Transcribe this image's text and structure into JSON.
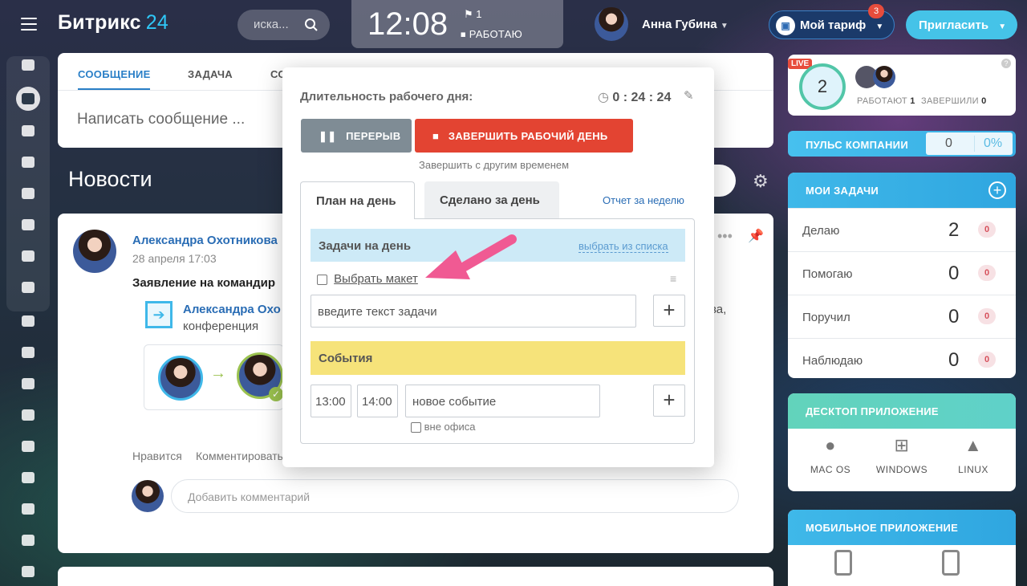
{
  "header": {
    "logo_main": "Битрикс",
    "logo_num": "24",
    "search_placeholder": "иска...",
    "clock_time": "12:08",
    "flag_count": "1",
    "work_status": "РАБОТАЮ",
    "user_name": "Анна Губина",
    "tariff_label": "Мой тариф",
    "tariff_badge": "3",
    "invite_label": "Пригласить"
  },
  "composer": {
    "tabs": [
      "СООБЩЕНИЕ",
      "ЗАДАЧА",
      "СО"
    ],
    "placeholder": "Написать сообщение ..."
  },
  "feed": {
    "title": "Новости",
    "post": {
      "author": "Александра Охотникова",
      "date": "28 апреля 17:03",
      "title": "Заявление на командир",
      "link_author": "Александра Охо",
      "link_text": "конференция",
      "link_tail": "ва,",
      "like": "Нравится",
      "comment": "Комментировать",
      "comment_placeholder": "Добавить комментарий"
    }
  },
  "popup": {
    "duration_label": "Длительность рабочего дня:",
    "duration_value": "0 : 24 : 24",
    "pause_label": "ПЕРЕРЫВ",
    "finish_label": "ЗАВЕРШИТЬ РАБОЧИЙ ДЕНЬ",
    "finish_other": "Завершить с другим временем",
    "tab_plan": "План на день",
    "tab_done": "Сделано за день",
    "weekly_report": "Отчет за неделю",
    "tasks_header": "Задачи на день",
    "choose_from_list": "выбрать из списка",
    "task_item": "Выбрать макет",
    "task_input_placeholder": "введите текст задачи",
    "events_header": "События",
    "time_from": "13:00",
    "time_to": "14:00",
    "event_placeholder": "новое событие",
    "out_of_office": "вне офиса"
  },
  "right": {
    "live": "LIVE",
    "working_count": "2",
    "working_label": "РАБОТАЮТ",
    "working_num": "1",
    "finished_label": "ЗАВЕРШИЛИ",
    "finished_num": "0",
    "pulse_label": "ПУЛЬС КОМПАНИИ",
    "pulse_value": "0",
    "pulse_percent": "0%",
    "my_tasks": "МОИ ЗАДАЧИ",
    "tasks": [
      {
        "label": "Делаю",
        "value": "2",
        "counter": "0"
      },
      {
        "label": "Помогаю",
        "value": "0",
        "counter": "0"
      },
      {
        "label": "Поручил",
        "value": "0",
        "counter": "0"
      },
      {
        "label": "Наблюдаю",
        "value": "0",
        "counter": "0"
      }
    ],
    "desktop_title": "ДЕСКТОП ПРИЛОЖЕНИЕ",
    "os": [
      "MAC OS",
      "WINDOWS",
      "LINUX"
    ],
    "mobile_title": "МОБИЛЬНОЕ ПРИЛОЖЕНИЕ"
  },
  "colors": {
    "accent": "#2fc7f7",
    "finish_red": "#e34432",
    "pause_gray": "#7f8c95",
    "tasks_blue": "#cdeaf7",
    "events_yellow": "#f6e37a",
    "arrow_pink": "#f05a93"
  }
}
